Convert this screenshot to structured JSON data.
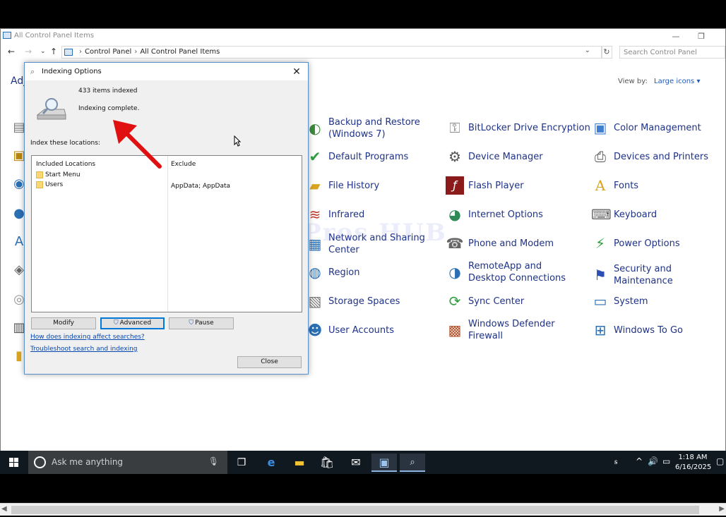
{
  "control_panel": {
    "title": "All Control Panel Items",
    "breadcrumb": [
      "Control Panel",
      "All Control Panel Items"
    ],
    "search_placeholder": "Search Control Panel",
    "adjust_label": "Adj",
    "view_by_label": "View by:",
    "view_by_value": "Large icons ▾",
    "items": [
      {
        "label": "Backup and Restore (Windows 7)",
        "icon": "backup-icon",
        "color": "#3a8b3a"
      },
      {
        "label": "BitLocker Drive Encryption",
        "icon": "bitlocker-icon",
        "color": "#8a8a8a"
      },
      {
        "label": "Color Management",
        "icon": "color-management-icon",
        "color": "#3f7fd1"
      },
      {
        "label": "Default Programs",
        "icon": "default-programs-icon",
        "color": "#2e9e3e"
      },
      {
        "label": "Device Manager",
        "icon": "device-manager-icon",
        "color": "#555555"
      },
      {
        "label": "Devices and Printers",
        "icon": "printer-icon",
        "color": "#555555"
      },
      {
        "label": "File History",
        "icon": "file-history-icon",
        "color": "#d9a520"
      },
      {
        "label": "Flash Player",
        "icon": "flash-player-icon",
        "color": "#8b1a1a"
      },
      {
        "label": "Fonts",
        "icon": "fonts-icon",
        "color": "#d9a520"
      },
      {
        "label": "Infrared",
        "icon": "infrared-icon",
        "color": "#c0392b"
      },
      {
        "label": "Internet Options",
        "icon": "internet-options-icon",
        "color": "#2e8b57"
      },
      {
        "label": "Keyboard",
        "icon": "keyboard-icon",
        "color": "#666666"
      },
      {
        "label": "Network and Sharing Center",
        "icon": "network-icon",
        "color": "#2b6fb4"
      },
      {
        "label": "Phone and Modem",
        "icon": "phone-modem-icon",
        "color": "#666666"
      },
      {
        "label": "Power Options",
        "icon": "power-options-icon",
        "color": "#2e9e3e"
      },
      {
        "label": "Region",
        "icon": "region-icon",
        "color": "#2b6fb4"
      },
      {
        "label": "RemoteApp and Desktop Connections",
        "icon": "remoteapp-icon",
        "color": "#2b6fb4"
      },
      {
        "label": "Security and Maintenance",
        "icon": "security-flag-icon",
        "color": "#2b4fb4"
      },
      {
        "label": "Storage Spaces",
        "icon": "storage-spaces-icon",
        "color": "#777777"
      },
      {
        "label": "Sync Center",
        "icon": "sync-center-icon",
        "color": "#2e9e3e"
      },
      {
        "label": "System",
        "icon": "system-icon",
        "color": "#2b6fb4"
      },
      {
        "label": "User Accounts",
        "icon": "user-accounts-icon",
        "color": "#2b6fb4"
      },
      {
        "label": "Windows Defender Firewall",
        "icon": "firewall-icon",
        "color": "#b5502a"
      },
      {
        "label": "Windows To Go",
        "icon": "windows-to-go-icon",
        "color": "#2b6fb4"
      }
    ]
  },
  "indexing_dialog": {
    "title": "Indexing Options",
    "items_indexed": "433 items indexed",
    "status": "Indexing complete.",
    "locations_label": "Index these locations:",
    "col_included": "Included Locations",
    "col_exclude": "Exclude",
    "locations": [
      "Start Menu",
      "Users"
    ],
    "exclude_value": "AppData; AppData",
    "btn_modify": "Modify",
    "btn_advanced": "Advanced",
    "btn_pause": "Pause",
    "link_affect": "How does indexing affect searches?",
    "link_troubleshoot": "Troubleshoot search and indexing",
    "btn_close": "Close"
  },
  "watermark": "IT Pros HUB",
  "taskbar": {
    "search_placeholder": "Ask me anything",
    "time": "1:18 AM",
    "date": "6/16/2025"
  },
  "colors": {
    "link_blue": "#1e3287",
    "taskbar": "#101820",
    "arrow_red": "#e01010"
  }
}
